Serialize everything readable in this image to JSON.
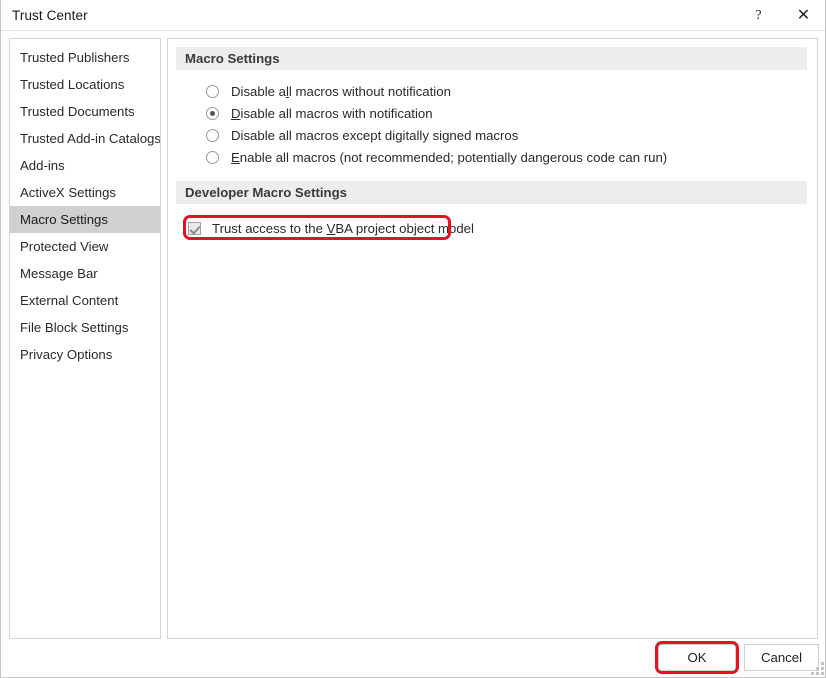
{
  "window": {
    "title": "Trust Center",
    "help_label": "?",
    "close_label": "✕"
  },
  "sidebar": {
    "items": [
      {
        "label": "Trusted Publishers",
        "selected": false
      },
      {
        "label": "Trusted Locations",
        "selected": false
      },
      {
        "label": "Trusted Documents",
        "selected": false
      },
      {
        "label": "Trusted Add-in Catalogs",
        "selected": false
      },
      {
        "label": "Add-ins",
        "selected": false
      },
      {
        "label": "ActiveX Settings",
        "selected": false
      },
      {
        "label": "Macro Settings",
        "selected": true
      },
      {
        "label": "Protected View",
        "selected": false
      },
      {
        "label": "Message Bar",
        "selected": false
      },
      {
        "label": "External Content",
        "selected": false
      },
      {
        "label": "File Block Settings",
        "selected": false
      },
      {
        "label": "Privacy Options",
        "selected": false
      }
    ]
  },
  "main": {
    "macro_settings": {
      "header": "Macro Settings",
      "options": [
        {
          "label": "Disable all macros without notification",
          "accesskey_before": "Disable a",
          "accesskey": "l",
          "accesskey_after": "l macros without notification",
          "selected": false
        },
        {
          "label": "Disable all macros with notification",
          "accesskey_before": "",
          "accesskey": "D",
          "accesskey_after": "isable all macros with notification",
          "selected": true
        },
        {
          "label": "Disable all macros except digitally signed macros",
          "accesskey_before": "Disable all macros except di",
          "accesskey": "g",
          "accesskey_after": "itally signed macros",
          "selected": false
        },
        {
          "label": "Enable all macros (not recommended; potentially dangerous code can run)",
          "accesskey_before": "",
          "accesskey": "E",
          "accesskey_after": "nable all macros (not recommended; potentially dangerous code can run)",
          "selected": false
        }
      ]
    },
    "developer_macro_settings": {
      "header": "Developer Macro Settings",
      "checkbox": {
        "label": "Trust access to the VBA project object model",
        "accesskey_before": "Trust access to the ",
        "accesskey": "V",
        "accesskey_after": "BA project object model",
        "checked": true
      }
    }
  },
  "footer": {
    "ok_label": "OK",
    "cancel_label": "Cancel"
  },
  "annotations": {
    "color": "#e81123",
    "targets": [
      "Trust access to the VBA project object model",
      "OK"
    ]
  }
}
